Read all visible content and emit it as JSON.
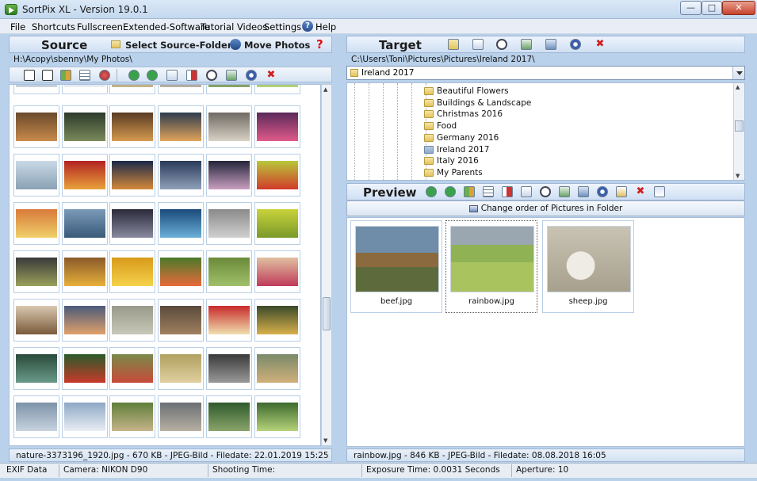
{
  "window": {
    "title": "SortPix XL - Version 19.0.1"
  },
  "menu": [
    "File",
    "Shortcuts",
    "Fullscreen",
    "Extended-Software",
    "Tutorial Videos",
    "Settings",
    "Help"
  ],
  "source": {
    "title": "Source",
    "select_folder": "Select Source-Folder",
    "move_photos": "Move Photos",
    "path": "H:\\Acopy\\sbenny\\My Photos\\",
    "status": "nature-3373196_1920.jpg - 670 KB - JPEG-Bild - Filedate: 22.01.2019 15:25"
  },
  "target": {
    "title": "Target",
    "path": "C:\\Users\\Toni\\Pictures\\Pictures\\Ireland 2017\\",
    "combo_value": "Ireland 2017",
    "folders": [
      "Beautiful Flowers",
      "Buildings & Landscape",
      "Christmas 2016",
      "Food",
      "Germany 2016",
      "Ireland 2017",
      "Italy 2016",
      "My Parents"
    ],
    "status": "rainbow.jpg - 846 KB - JPEG-Bild - Filedate: 08.08.2018 16:05"
  },
  "preview": {
    "title": "Preview",
    "change_order": "Change order of Pictures in Folder",
    "items": [
      "beef.jpg",
      "rainbow.jpg",
      "sheep.jpg"
    ]
  },
  "footer": {
    "exif": "EXIF Data",
    "camera": "Camera: NIKON D90",
    "shooting": "Shooting Time:",
    "exposure": "Exposure Time: 0.0031 Seconds",
    "aperture": "Aperture: 10"
  }
}
